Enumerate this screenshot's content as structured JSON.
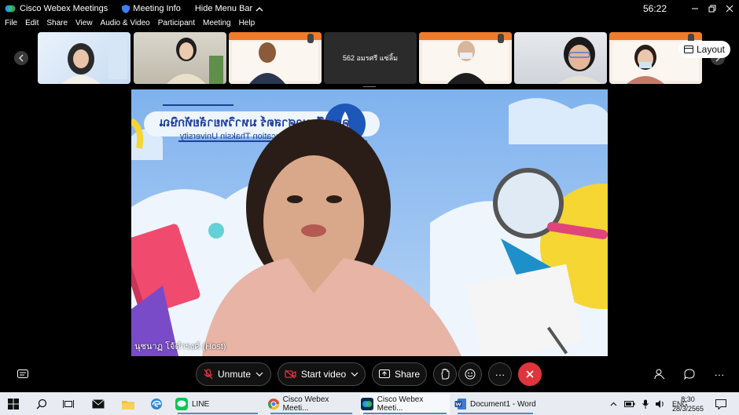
{
  "titlebar": {
    "app_name": "Cisco Webex Meetings",
    "meeting_info": "Meeting Info",
    "hide_menu": "Hide Menu Bar",
    "timer": "56:22"
  },
  "menu": [
    "File",
    "Edit",
    "Share",
    "View",
    "Audio & Video",
    "Participant",
    "Meeting",
    "Help"
  ],
  "participants_strip": {
    "count_tile": "562 อมรศรี แซ่ลิ้ม",
    "layout_label": "Layout"
  },
  "main_video": {
    "presenter_label": "นุชนาฏ โจ้ดำรงค์ (Host)",
    "banner_line1": "คณะศึกษาศาสตร์ มหาวิทยาลัยทักษิณ",
    "banner_line2": "Faculty of Education Thaksin University"
  },
  "controls": {
    "unmute": "Unmute",
    "start_video": "Start video",
    "share": "Share",
    "more": "···"
  },
  "taskbar": {
    "apps": [
      {
        "label": "LINE"
      },
      {
        "label": "Cisco Webex Meeti..."
      },
      {
        "label": "Cisco Webex Meeti..."
      },
      {
        "label": "Document1 - Word"
      }
    ],
    "lang": "ENG",
    "time": "8:30",
    "date": "28/3/2565"
  },
  "colors": {
    "end_call": "#e0343c",
    "background": "#000000",
    "taskbar": "#e8ecf2"
  }
}
